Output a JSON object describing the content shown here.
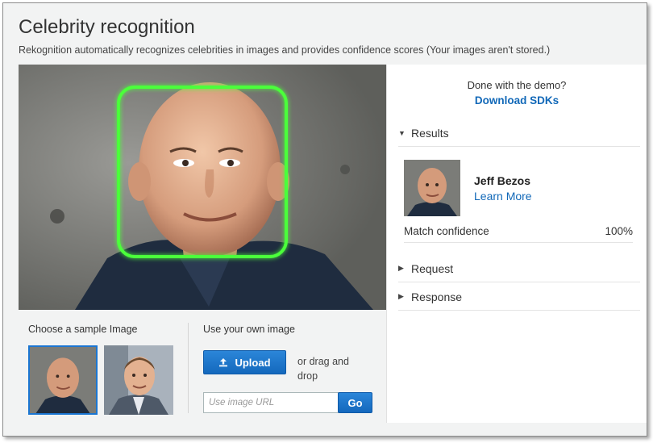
{
  "header": {
    "title": "Celebrity recognition",
    "subtitle": "Rekognition automatically recognizes celebrities in images and provides confidence scores (Your images aren't stored.)"
  },
  "samples": {
    "label": "Choose a sample Image"
  },
  "own_image": {
    "label": "Use your own image",
    "upload_label": "Upload",
    "drag_text": "or drag and drop",
    "url_placeholder": "Use image URL",
    "go_label": "Go"
  },
  "right": {
    "done_text": "Done with the demo?",
    "download_label": "Download SDKs",
    "results_label": "Results",
    "celebrity": {
      "name": "Jeff Bezos",
      "learn_more": "Learn More",
      "match_label": "Match confidence",
      "match_value": "100%"
    },
    "request_label": "Request",
    "response_label": "Response"
  },
  "colors": {
    "accent": "#1168b8",
    "button": "#1b76d2",
    "face_box": "#4cff3a"
  },
  "icons": {
    "upload": "upload-icon",
    "results_caret": "caret-down-icon",
    "request_caret": "caret-right-icon",
    "response_caret": "caret-right-icon"
  }
}
